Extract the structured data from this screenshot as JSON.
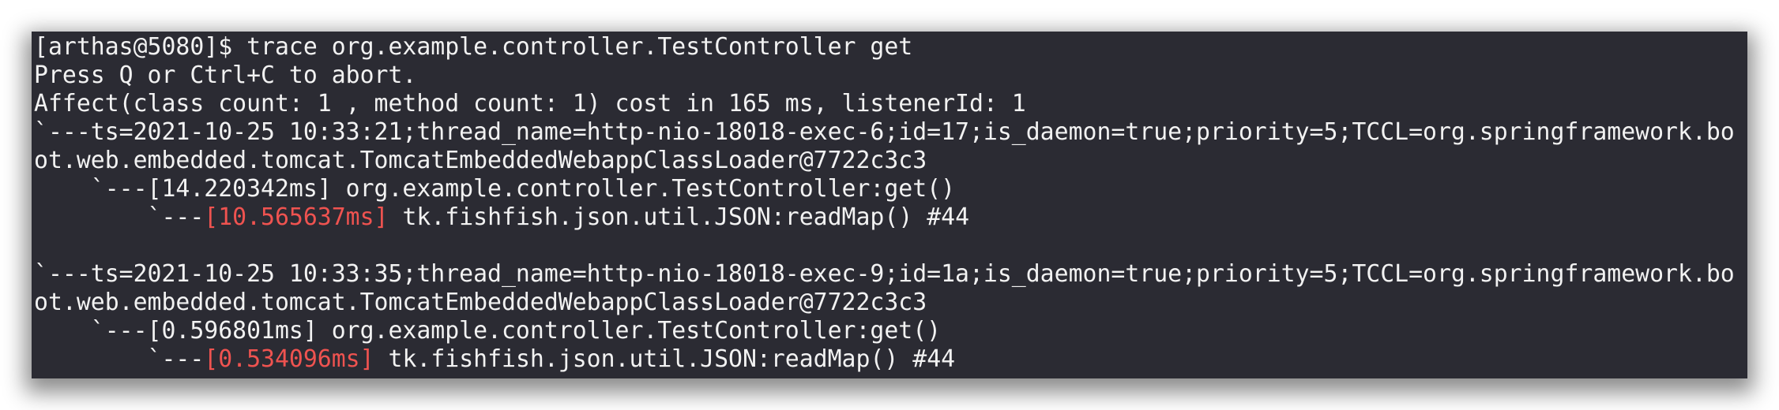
{
  "terminal": {
    "background": "#2b2b33",
    "text_color": "#f2f2f2",
    "highlight_color": "#ef5350",
    "lines": [
      {
        "text": "[arthas@5080]$ trace org.example.controller.TestController get"
      },
      {
        "text": "Press Q or Ctrl+C to abort."
      },
      {
        "text": "Affect(class count: 1 , method count: 1) cost in 165 ms, listenerId: 1"
      },
      {
        "text": "`---ts=2021-10-25 10:33:21;thread_name=http-nio-18018-exec-6;id=17;is_daemon=true;priority=5;TCCL=org.springframework.bo"
      },
      {
        "text": "ot.web.embedded.tomcat.TomcatEmbeddedWebappClassLoader@7722c3c3"
      },
      {
        "text": "    `---[14.220342ms] org.example.controller.TestController:get()"
      },
      {
        "prefix": "        `---",
        "timing": "[10.565637ms]",
        "suffix": " tk.fishfish.json.util.JSON:readMap() #44"
      },
      {
        "text": ""
      },
      {
        "text": "`---ts=2021-10-25 10:33:35;thread_name=http-nio-18018-exec-9;id=1a;is_daemon=true;priority=5;TCCL=org.springframework.bo"
      },
      {
        "text": "ot.web.embedded.tomcat.TomcatEmbeddedWebappClassLoader@7722c3c3"
      },
      {
        "text": "    `---[0.596801ms] org.example.controller.TestController:get()"
      },
      {
        "prefix": "        `---",
        "timing": "[0.534096ms]",
        "suffix": " tk.fishfish.json.util.JSON:readMap() #44"
      }
    ]
  }
}
